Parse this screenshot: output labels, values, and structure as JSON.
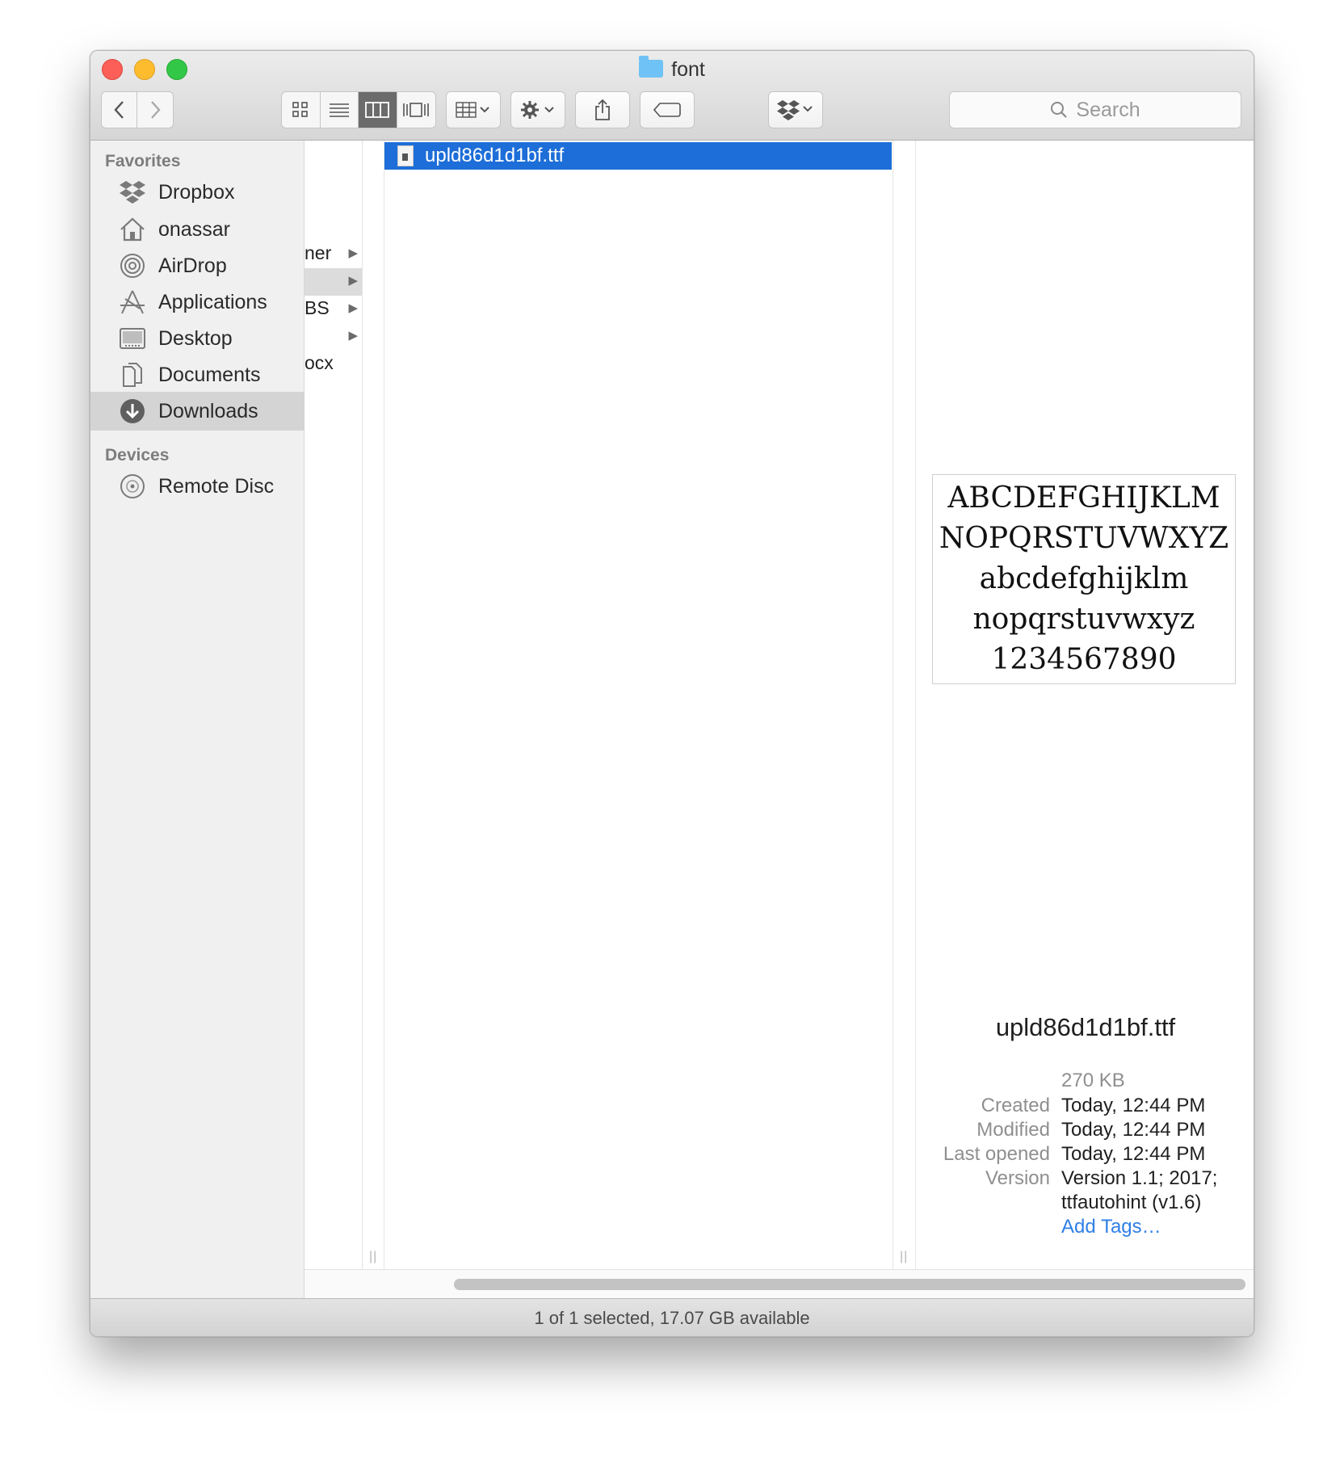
{
  "window": {
    "title": "font",
    "traffic_lights": {
      "close": "#fc5f57",
      "minimize": "#fdbc2e",
      "maximize": "#33c748"
    }
  },
  "toolbar": {
    "search_placeholder": "Search",
    "view_modes": [
      "icon-view",
      "list-view",
      "column-view",
      "cover-flow-view"
    ],
    "active_view": "column-view"
  },
  "sidebar": {
    "favorites_header": "Favorites",
    "favorites": [
      {
        "label": "Dropbox",
        "icon": "dropbox-icon"
      },
      {
        "label": "onassar",
        "icon": "home-icon"
      },
      {
        "label": "AirDrop",
        "icon": "airdrop-icon"
      },
      {
        "label": "Applications",
        "icon": "applications-icon"
      },
      {
        "label": "Desktop",
        "icon": "desktop-icon"
      },
      {
        "label": "Documents",
        "icon": "documents-icon"
      },
      {
        "label": "Downloads",
        "icon": "downloads-icon",
        "selected": true
      }
    ],
    "devices_header": "Devices",
    "devices": [
      {
        "label": "Remote Disc",
        "icon": "disc-icon"
      }
    ]
  },
  "columns": {
    "parent_fragments": [
      "ner",
      "",
      "BS",
      "",
      "ocx"
    ],
    "selected_file": "upld86d1d1bf.ttf"
  },
  "preview": {
    "sample_lines": [
      "ABCDEFGHIJKLM",
      "NOPQRSTUVWXYZ",
      "abcdefghijklm",
      "nopqrstuvwxyz",
      "1234567890"
    ],
    "file_name": "upld86d1d1bf.ttf",
    "size": "270 KB",
    "created_label": "Created",
    "created": "Today, 12:44 PM",
    "modified_label": "Modified",
    "modified": "Today, 12:44 PM",
    "last_opened_label": "Last opened",
    "last_opened": "Today, 12:44 PM",
    "version_label": "Version",
    "version_line1": "Version 1.1; 2017;",
    "version_line2": "ttfautohint (v1.6)",
    "add_tags": "Add Tags…"
  },
  "status_bar": {
    "text": "1 of 1 selected, 17.07 GB available"
  },
  "colors": {
    "selection": "#1d6ed8",
    "link": "#2f7fe6",
    "folder": "#6ec2f5"
  }
}
